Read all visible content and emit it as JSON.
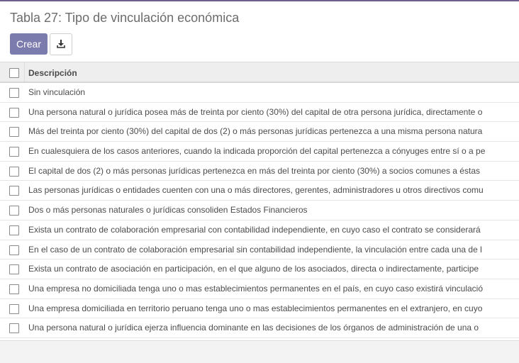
{
  "page": {
    "title": "Tabla 27: Tipo de vinculación económica"
  },
  "toolbar": {
    "create_label": "Crear",
    "download_icon": "download-icon",
    "accent_color": "#7c7bad"
  },
  "table": {
    "header": "Descripción",
    "rows": [
      "Sin vinculación",
      "Una persona natural o jurídica posea más de treinta por ciento (30%) del capital de otra persona jurídica, directamente o",
      "Más del treinta por ciento (30%) del capital de dos (2) o más personas jurídicas pertenezca a una misma persona natura",
      "En cualesquiera de los casos anteriores, cuando la indicada proporción del capital pertenezca a cónyuges entre sí o a pe",
      "El capital de dos (2) o más personas jurídicas pertenezca en más del treinta por ciento (30%) a socios comunes a éstas",
      "Las personas jurídicas o entidades cuenten con una o más directores, gerentes, administradores u otros directivos comu",
      "Dos o más personas naturales o jurídicas consoliden Estados Financieros",
      "Exista un contrato de colaboración empresarial con contabilidad independiente, en cuyo caso el contrato se considerará",
      "En el caso de un contrato de colaboración empresarial sin contabilidad independiente, la vinculación entre cada una de l",
      "Exista un contrato de asociación en participación, en el que alguno de los asociados, directa o indirectamente, participe",
      "Una empresa no domiciliada tenga uno o mas establecimientos permanentes en el país, en cuyo caso existirá vinculació",
      "Una empresa domiciliada en territorio peruano tenga uno o mas establecimientos permanentes en el extranjero, en cuyo",
      "Una persona natural o jurídica ejerza influencia dominante en las decisiones de los órganos de administración de una o"
    ]
  }
}
